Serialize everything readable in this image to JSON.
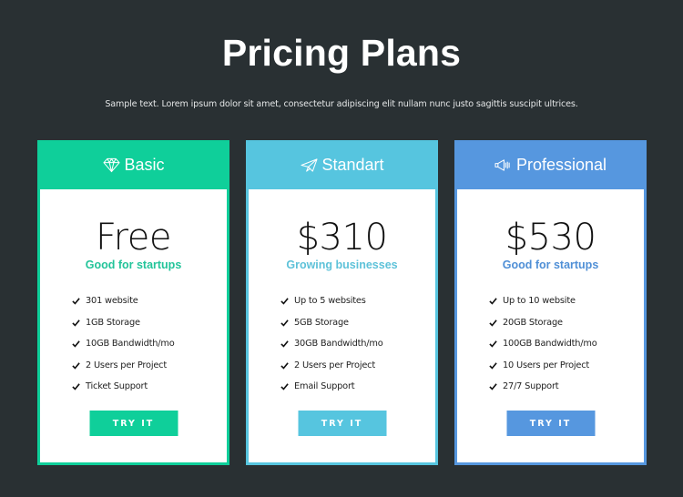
{
  "header": {
    "title": "Pricing Plans",
    "subtitle": "Sample text. Lorem ipsum dolor sit amet, consectetur adipiscing elit nullam nunc justo sagittis suscipit ultrices."
  },
  "plans": [
    {
      "name": "Basic",
      "icon": "diamond-icon",
      "accent": "#0fcf9a",
      "accent_text": "#23c49a",
      "price": "Free",
      "tagline": "Good for startups",
      "features": [
        "301 website",
        "1GB Storage",
        "10GB Bandwidth/mo",
        "2 Users per Project",
        "Ticket Support"
      ],
      "button_label": "TRY IT"
    },
    {
      "name": "Standart",
      "icon": "paper-plane-icon",
      "accent": "#56c5df",
      "accent_text": "#5ec2d9",
      "price": "$310",
      "tagline": "Growing businesses",
      "features": [
        "Up to 5 websites",
        "5GB Storage",
        "30GB Bandwidth/mo",
        "2 Users per Project",
        "Email Support"
      ],
      "button_label": "TRY IT"
    },
    {
      "name": "Professional",
      "icon": "megaphone-icon",
      "accent": "#5697df",
      "accent_text": "#4f8fd6",
      "price": "$530",
      "tagline": "Good for startups",
      "features": [
        "Up to 10 website",
        "20GB Storage",
        "100GB Bandwidth/mo",
        "10 Users per Project",
        "27/7 Support"
      ],
      "button_label": "TRY IT"
    }
  ]
}
